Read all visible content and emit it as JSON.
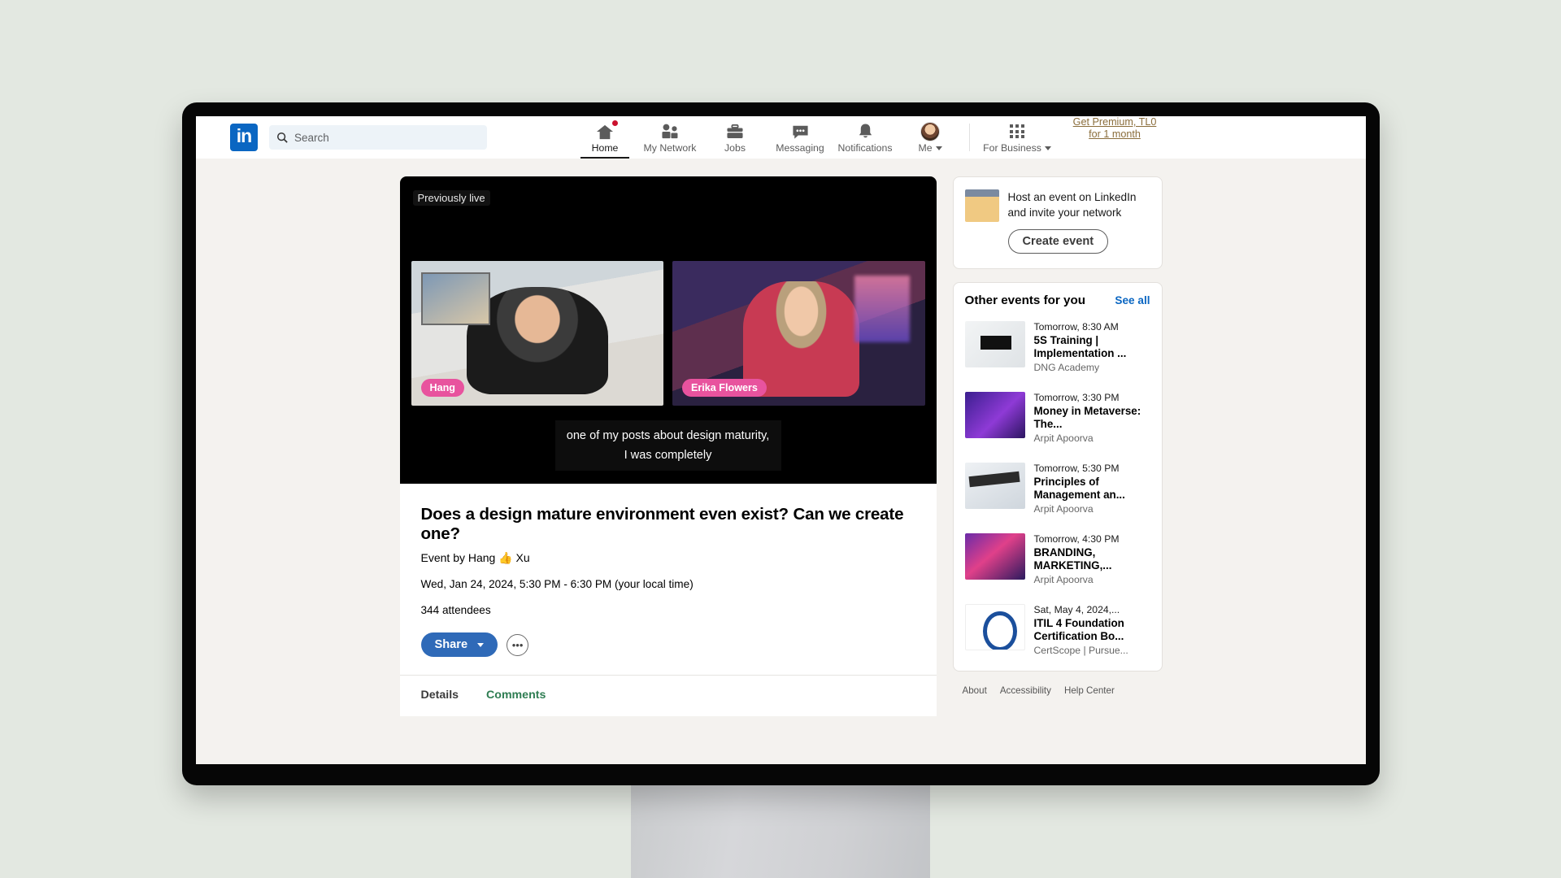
{
  "nav": {
    "logo_text": "in",
    "search_placeholder": "Search",
    "items": [
      {
        "label": "Home",
        "icon": "home-icon",
        "active": true,
        "badge": true
      },
      {
        "label": "My Network",
        "icon": "people-icon",
        "active": false,
        "badge": false
      },
      {
        "label": "Jobs",
        "icon": "briefcase-icon",
        "active": false,
        "badge": false
      },
      {
        "label": "Messaging",
        "icon": "message-icon",
        "active": false,
        "badge": false
      },
      {
        "label": "Notifications",
        "icon": "bell-icon",
        "active": false,
        "badge": false
      },
      {
        "label": "Me",
        "icon": "avatar-icon",
        "active": false,
        "badge": false
      }
    ],
    "for_business": "For Business",
    "premium_line1": "Get Premium, TL0",
    "premium_line2": "for 1 month"
  },
  "video": {
    "status_badge": "Previously live",
    "speakers": [
      {
        "name": "Hang"
      },
      {
        "name": "Erika Flowers"
      }
    ],
    "caption": "one of my posts about design maturity, I was completely"
  },
  "event": {
    "title": "Does a design mature environment even exist? Can we create one?",
    "by_prefix": "Event by ",
    "host": "Hang 👍 Xu",
    "datetime": "Wed, Jan 24, 2024, 5:30 PM - 6:30 PM (your local time)",
    "attendees": "344 attendees",
    "share_label": "Share",
    "more_label": "•••",
    "tabs": [
      {
        "label": "Details",
        "active": true
      },
      {
        "label": "Comments",
        "active": false
      }
    ]
  },
  "sidebar": {
    "host_promo": {
      "text": "Host an event on LinkedIn and invite your network",
      "button": "Create event"
    },
    "other_events": {
      "heading": "Other events for you",
      "see_all": "See all",
      "items": [
        {
          "when": "Tomorrow, 8:30 AM",
          "title": "5S Training | Implementation ...",
          "org": "DNG Academy",
          "thumb": "t1"
        },
        {
          "when": "Tomorrow, 3:30 PM",
          "title": "Money in Metaverse: The...",
          "org": "Arpit Apoorva",
          "thumb": "t2"
        },
        {
          "when": "Tomorrow, 5:30 PM",
          "title": "Principles of Management an...",
          "org": "Arpit Apoorva",
          "thumb": "t3"
        },
        {
          "when": "Tomorrow, 4:30 PM",
          "title": "BRANDING, MARKETING,...",
          "org": "Arpit Apoorva",
          "thumb": "t4"
        },
        {
          "when": "Sat, May 4, 2024,...",
          "title": "ITIL 4 Foundation Certification Bo...",
          "org": "CertScope | Pursue...",
          "thumb": "t5"
        }
      ]
    },
    "footer_links": [
      "About",
      "Accessibility",
      "Help Center"
    ]
  },
  "colors": {
    "brand_blue": "#0a66c2",
    "share_blue": "#2f6ab8",
    "name_tag_pink": "#e8539e",
    "premium_gold": "#8a6d3b",
    "comments_green": "#2e7d52",
    "notification_red": "#cb112d"
  }
}
